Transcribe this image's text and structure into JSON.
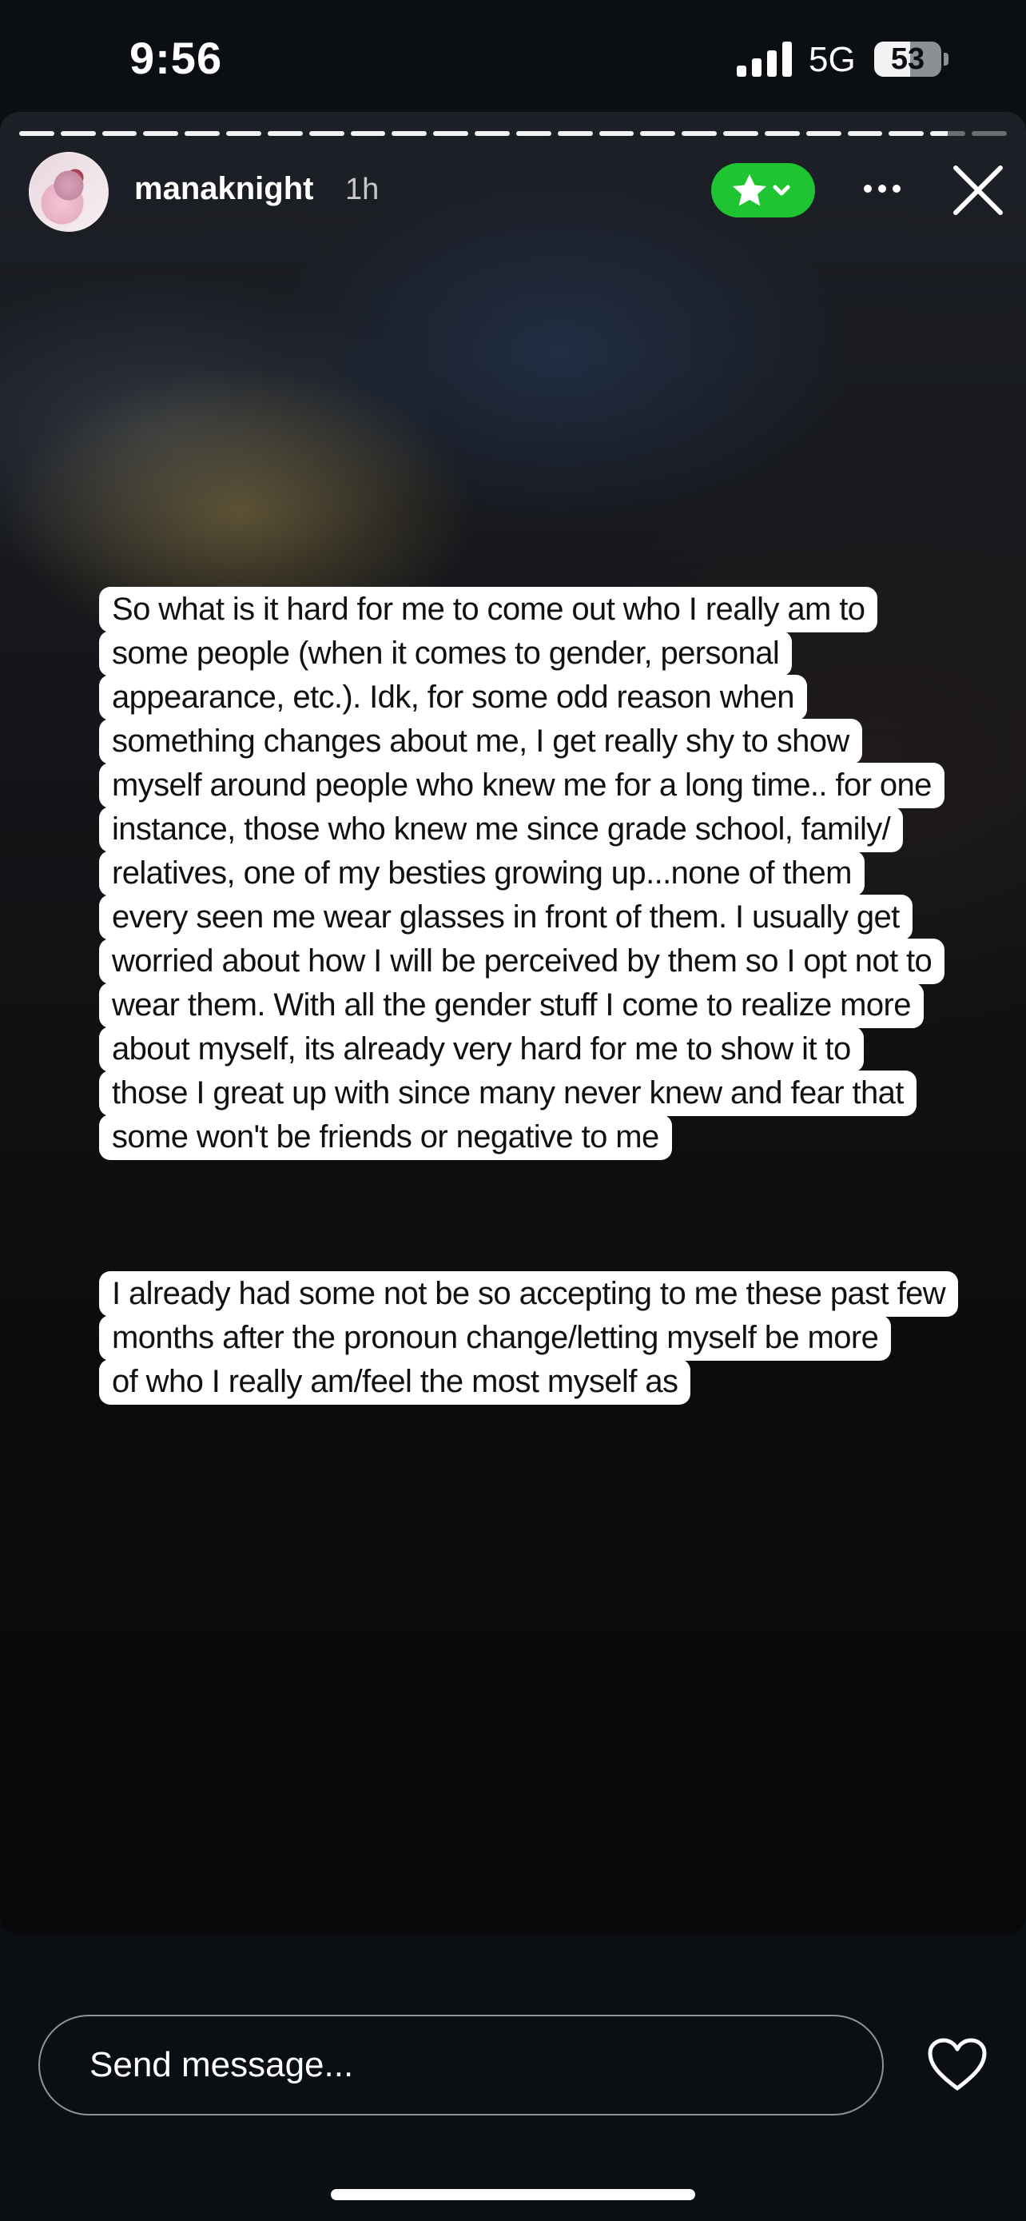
{
  "status_bar": {
    "time": "9:56",
    "network": "5G",
    "battery_level": "53",
    "battery_fraction": 0.53
  },
  "story": {
    "username": "manaknight",
    "posted_ago": "1h",
    "progress_segments": 24,
    "progress_current_index": 22,
    "badge_icon": "star-icon",
    "badge_color": "#1ec431",
    "captions": [
      {
        "lines": [
          "So what is it hard for me to come out who I really am to",
          "some people (when it comes to gender, personal",
          "appearance, etc.).  Idk, for some odd reason when",
          "something changes about me, I get really shy to show",
          "myself around people who knew me for a long time..  for one",
          "instance, those who knew me since grade school, family/",
          "relatives, one of my besties growing up...none of them",
          "every seen me wear glasses in front of them. I usually get",
          "worried about how I will be perceived by them so I opt not to",
          "wear them.  With all the gender stuff I come to realize more",
          "about myself, its already very hard for me to show it to",
          "those I great up with since many never knew and fear that",
          "some won't be friends or negative to me"
        ]
      },
      {
        "lines": [
          "I already had some not be so accepting to me these past few",
          "months after the pronoun change/letting myself be more",
          "of who I really am/feel the most myself as"
        ]
      }
    ]
  },
  "bottom_bar": {
    "message_placeholder": "Send message...",
    "like_icon": "heart-icon"
  }
}
